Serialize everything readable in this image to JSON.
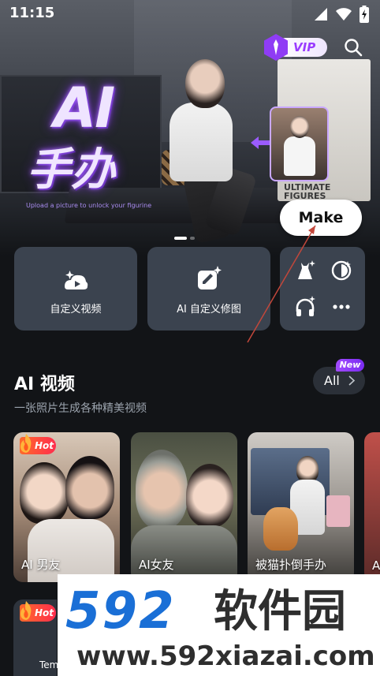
{
  "status_bar": {
    "time": "11:15"
  },
  "hero": {
    "title": "AI",
    "subtitle": "手办",
    "caption": "Upload a picture to unlock your figurine",
    "box_text": "ULTIMATE FIGURES",
    "make_label": "Make",
    "vip_label": "VIP",
    "page_count": 3,
    "active_page": 0
  },
  "tools": [
    {
      "label": "自定义视频",
      "icon": "video-sparkle-icon"
    },
    {
      "label": "AI 自定义修图",
      "icon": "edit-sparkle-icon"
    }
  ],
  "mini_tools": [
    {
      "icon": "dress-sparkle-icon"
    },
    {
      "icon": "face-swap-icon"
    },
    {
      "icon": "headphones-sparkle-icon"
    },
    {
      "icon": "more-icon"
    }
  ],
  "section": {
    "title": "AI 视频",
    "subtitle": "一张照片生成各种精美视频",
    "all_label": "All",
    "new_badge": "New"
  },
  "videos": [
    {
      "label": "AI 男友",
      "badge": "Hot"
    },
    {
      "label": "AI女友",
      "badge": ""
    },
    {
      "label": "被猫扑倒手办",
      "badge": ""
    },
    {
      "label": "AI",
      "badge": ""
    }
  ],
  "row2": {
    "badge": "Hot",
    "label": "Tem"
  },
  "watermark": {
    "brand_number": "592",
    "brand_cn": "软件园",
    "url": "www.592xiazai.com"
  },
  "colors": {
    "accent_purple": "#9a3cff",
    "hot_red": "#ff2d4e",
    "card_bg": "#3b434f",
    "bg": "#121417"
  }
}
